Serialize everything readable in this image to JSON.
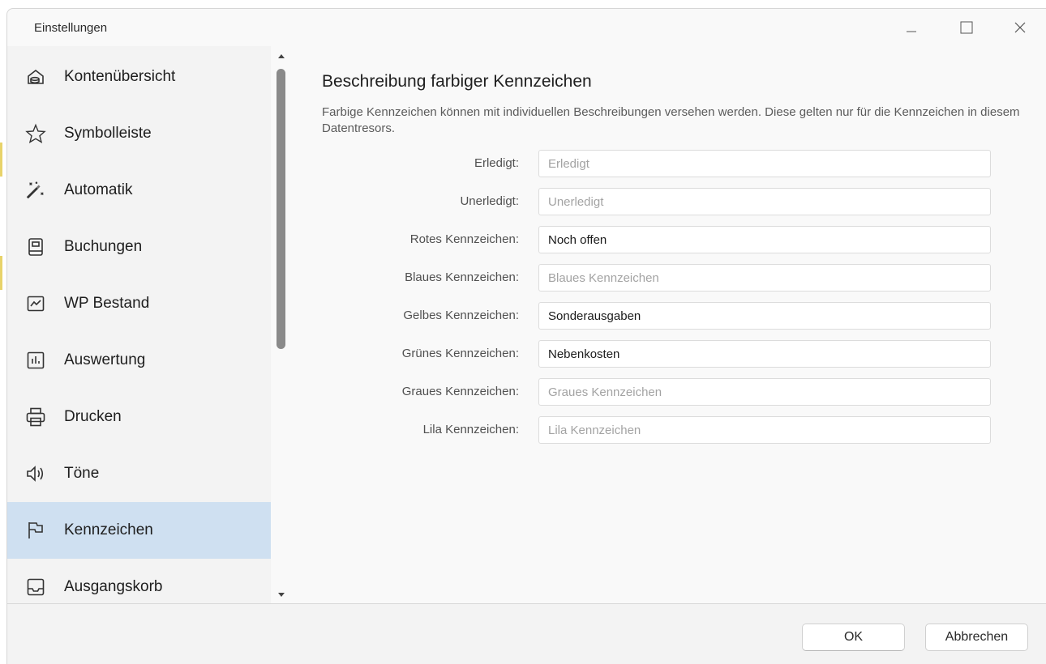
{
  "window": {
    "title": "Einstellungen",
    "controls": [
      "minimize-icon",
      "maximize-icon",
      "close-icon"
    ]
  },
  "sidebar": {
    "items": [
      {
        "label": "Kontenübersicht",
        "icon": "account-overview-icon"
      },
      {
        "label": "Symbolleiste",
        "icon": "star-icon"
      },
      {
        "label": "Automatik",
        "icon": "magic-wand-icon"
      },
      {
        "label": "Buchungen",
        "icon": "ledger-book-icon"
      },
      {
        "label": "WP Bestand",
        "icon": "stock-chart-icon"
      },
      {
        "label": "Auswertung",
        "icon": "bar-chart-icon"
      },
      {
        "label": "Drucken",
        "icon": "printer-icon"
      },
      {
        "label": "Töne",
        "icon": "speaker-icon"
      },
      {
        "label": "Kennzeichen",
        "icon": "flag-icon",
        "active": true
      },
      {
        "label": "Ausgangskorb",
        "icon": "outbox-tray-icon"
      }
    ],
    "active_color": "#cfe0f1"
  },
  "main": {
    "heading": "Beschreibung farbiger Kennzeichen",
    "description": "Farbige Kennzeichen können mit individuellen Beschreibungen versehen werden. Diese gelten nur für die Kennzeichen in diesem Datentresors.",
    "fields": [
      {
        "label": "Erledigt:",
        "value": "",
        "placeholder": "Erledigt"
      },
      {
        "label": "Unerledigt:",
        "value": "",
        "placeholder": "Unerledigt"
      },
      {
        "label": "Rotes Kennzeichen:",
        "value": "Noch offen",
        "placeholder": "Rotes Kennzeichen"
      },
      {
        "label": "Blaues Kennzeichen:",
        "value": "",
        "placeholder": "Blaues Kennzeichen"
      },
      {
        "label": "Gelbes Kennzeichen:",
        "value": "Sonderausgaben",
        "placeholder": "Gelbes Kennzeichen"
      },
      {
        "label": "Grünes Kennzeichen:",
        "value": "Nebenkosten",
        "placeholder": "Grünes Kennzeichen"
      },
      {
        "label": "Graues Kennzeichen:",
        "value": "",
        "placeholder": "Graues Kennzeichen"
      },
      {
        "label": "Lila Kennzeichen:",
        "value": "",
        "placeholder": "Lila Kennzeichen"
      }
    ]
  },
  "footer": {
    "ok_label": "OK",
    "cancel_label": "Abbrechen"
  }
}
